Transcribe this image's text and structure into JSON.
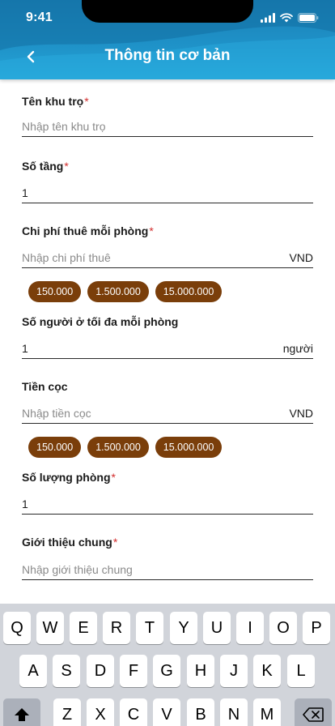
{
  "status_bar": {
    "time": "9:41"
  },
  "header": {
    "title": "Thông tin cơ bản"
  },
  "fields": {
    "name": {
      "label": "Tên khu trọ",
      "required": "*",
      "placeholder": "Nhập tên khu trọ"
    },
    "floors": {
      "label": "Số tầng",
      "required": "*",
      "value": "1"
    },
    "rent": {
      "label": "Chi phí thuê mỗi phòng",
      "required": "*",
      "placeholder": "Nhập chi phí thuê",
      "unit": "VND",
      "chips": [
        "150.000",
        "1.500.000",
        "15.000.000"
      ]
    },
    "max_people": {
      "label": "Số người ở tối đa mỗi phòng",
      "value": "1",
      "unit": "người"
    },
    "deposit": {
      "label": "Tiền cọc",
      "placeholder": "Nhập tiền cọc",
      "unit": "VND",
      "chips": [
        "150.000",
        "1.500.000",
        "15.000.000"
      ]
    },
    "rooms": {
      "label": "Số lượng phòng",
      "required": "*",
      "value": "1"
    },
    "intro": {
      "label": "Giới thiệu chung",
      "required": "*",
      "placeholder": "Nhập giới thiệu chung"
    }
  },
  "keyboard": {
    "row1": [
      "Q",
      "W",
      "E",
      "R",
      "T",
      "Y",
      "U",
      "I",
      "O",
      "P"
    ],
    "row2": [
      "A",
      "S",
      "D",
      "F",
      "G",
      "H",
      "J",
      "K",
      "L"
    ],
    "row3": [
      "Z",
      "X",
      "C",
      "V",
      "B",
      "N",
      "M"
    ]
  },
  "colors": {
    "header": "#1f93c9",
    "chip": "#7a3e0a",
    "required": "#d32f2f"
  }
}
